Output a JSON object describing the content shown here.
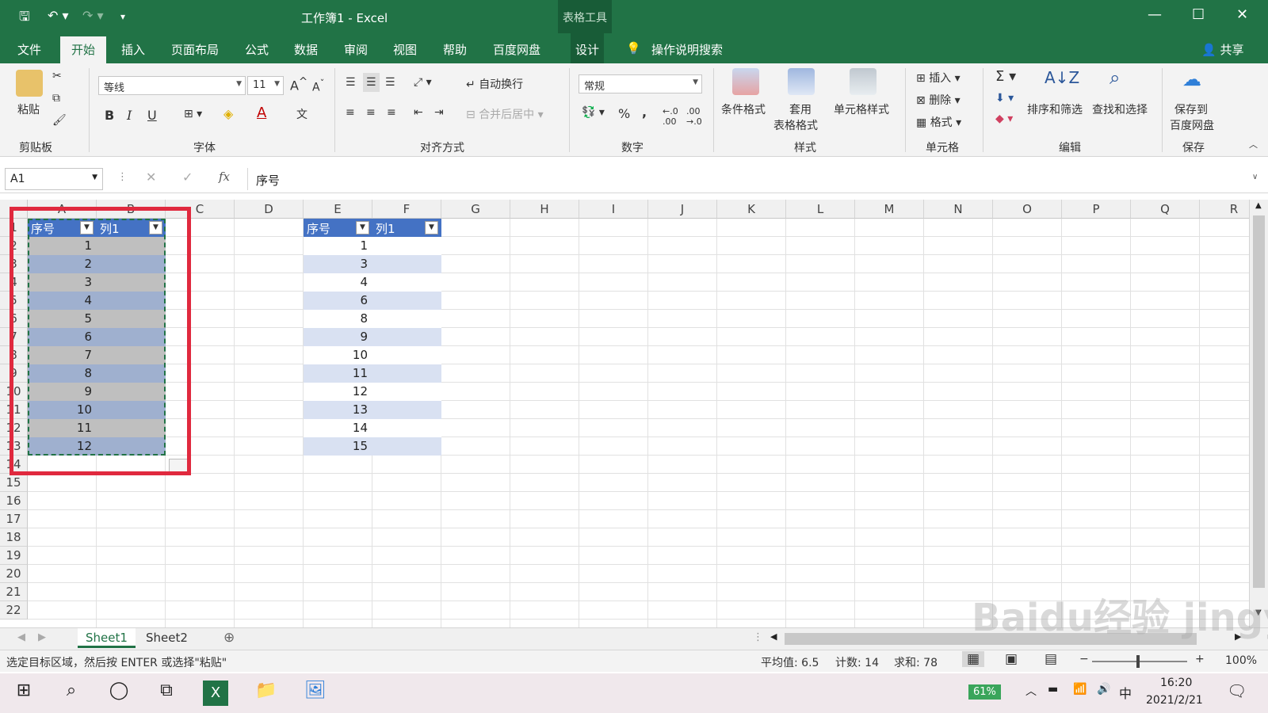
{
  "app": {
    "title": "工作簿1 - Excel",
    "context_tab": "表格工具"
  },
  "tabs": [
    "文件",
    "开始",
    "插入",
    "页面布局",
    "公式",
    "数据",
    "审阅",
    "视图",
    "帮助",
    "百度网盘",
    "设计"
  ],
  "tell_me": "操作说明搜索",
  "share": "共享",
  "ribbon": {
    "clipboard": {
      "paste": "粘贴",
      "label": "剪贴板"
    },
    "font": {
      "name": "等线",
      "size": "11",
      "label": "字体",
      "bold": "B",
      "italic": "I",
      "underline": "U"
    },
    "alignment": {
      "wrap": "自动换行",
      "merge": "合并后居中",
      "label": "对齐方式"
    },
    "number": {
      "format": "常规",
      "percent": "%",
      "comma": ",",
      "label": "数字"
    },
    "styles": {
      "conditional": "条件格式",
      "table_format_1": "套用",
      "table_format_2": "表格格式",
      "cell_styles": "单元格样式",
      "label": "样式"
    },
    "cells": {
      "insert": "插入",
      "delete": "删除",
      "format": "格式",
      "label": "单元格"
    },
    "editing": {
      "sort": "排序和筛选",
      "find": "查找和选择",
      "label": "编辑"
    },
    "save": {
      "line1": "保存到",
      "line2": "百度网盘",
      "label": "保存"
    }
  },
  "formula_bar": {
    "name_box": "A1",
    "fx": "fx",
    "content": "序号"
  },
  "columns": [
    "A",
    "B",
    "C",
    "D",
    "E",
    "F",
    "G",
    "H",
    "I",
    "J",
    "K",
    "L",
    "M",
    "N",
    "O",
    "P",
    "Q",
    "R"
  ],
  "rows": [
    "1",
    "2",
    "3",
    "4",
    "5",
    "6",
    "7",
    "8",
    "9",
    "10",
    "11",
    "12",
    "13",
    "14",
    "15",
    "16",
    "17",
    "18",
    "19",
    "20",
    "21",
    "22"
  ],
  "table1": {
    "headers": [
      "序号",
      "列1"
    ],
    "values": [
      "1",
      "2",
      "3",
      "4",
      "5",
      "6",
      "7",
      "8",
      "9",
      "10",
      "11",
      "12"
    ]
  },
  "table2": {
    "headers": [
      "序号",
      "列1"
    ],
    "values": [
      "1",
      "3",
      "4",
      "6",
      "8",
      "9",
      "10",
      "11",
      "12",
      "13",
      "14",
      "15"
    ]
  },
  "sheets": [
    "Sheet1",
    "Sheet2"
  ],
  "status": {
    "message": "选定目标区域，然后按 ENTER 或选择\"粘贴\"",
    "average": "平均值: 6.5",
    "count": "计数: 14",
    "sum": "求和: 78",
    "zoom": "100%"
  },
  "taskbar": {
    "battery": "61%",
    "ime": "中",
    "time": "16:20",
    "date": "2021/2/21"
  },
  "watermark": "Baidu经验 jingyan.baidu.com",
  "colors": {
    "excel_green": "#217346",
    "table_header": "#4472c4",
    "band": "#d9e1f2",
    "highlight_border": "#e0293e"
  }
}
